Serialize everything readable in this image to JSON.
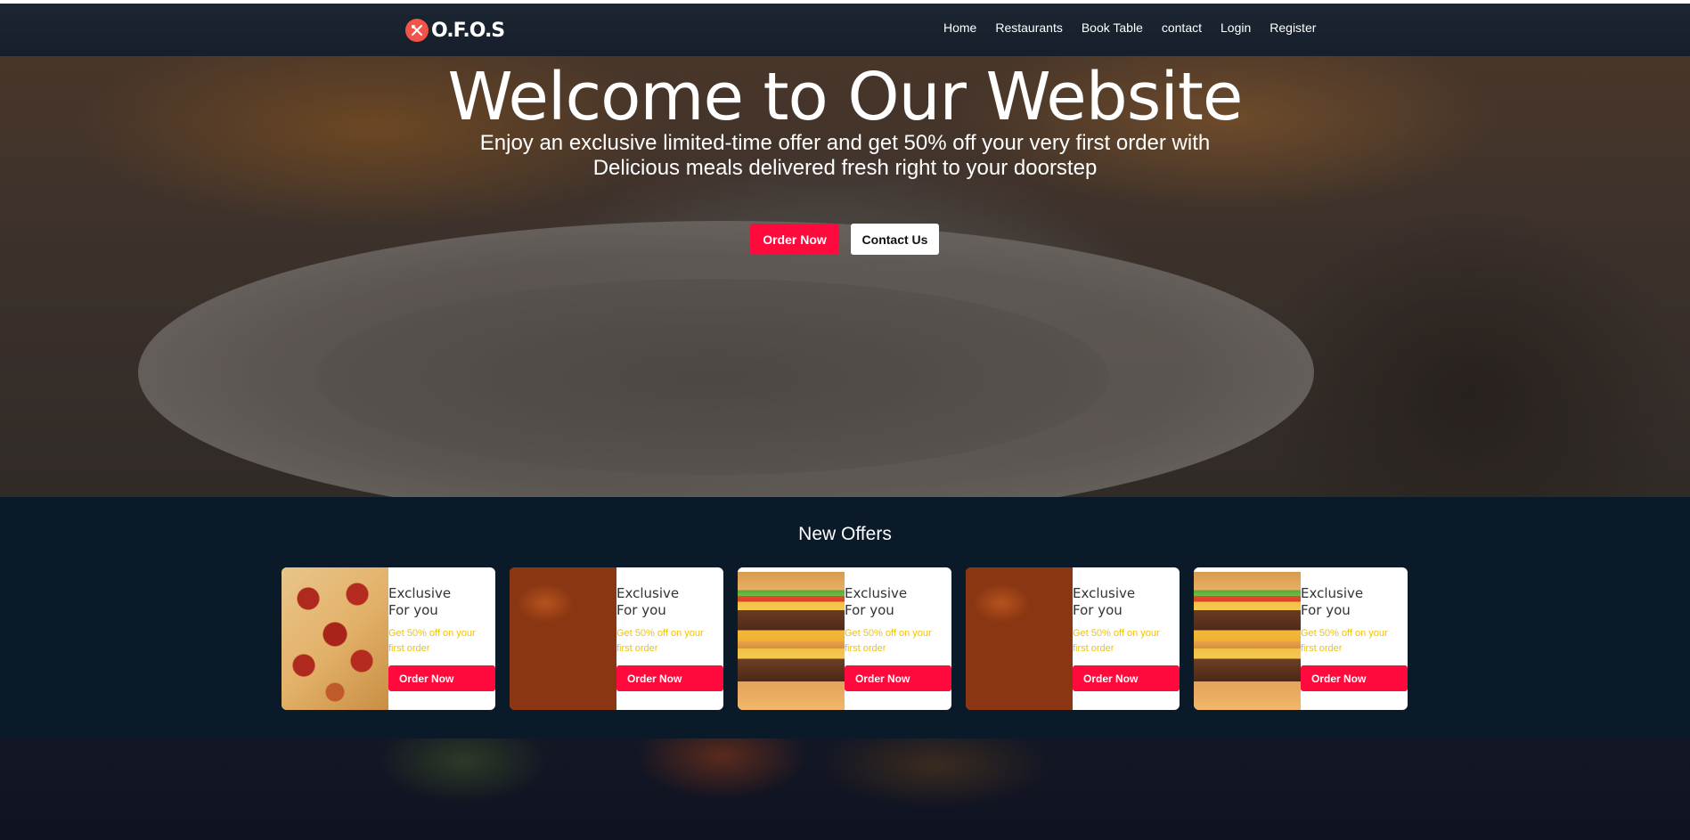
{
  "brand": {
    "name": "O.F.O.S",
    "icon": "fork-spoon-icon",
    "accent": "#f2544a"
  },
  "nav": {
    "items": [
      {
        "label": "Home"
      },
      {
        "label": "Restaurants"
      },
      {
        "label": "Book Table"
      },
      {
        "label": "contact"
      },
      {
        "label": "Login"
      },
      {
        "label": "Register"
      }
    ]
  },
  "hero": {
    "title": "Welcome to Our Website",
    "subtitle_line1": "Enjoy an exclusive limited-time offer and get 50% off your very first order with",
    "subtitle_line2": "Delicious meals delivered fresh right to your doorstep",
    "primary_button": "Order Now",
    "secondary_button": "Contact Us",
    "primary_color": "#ff0a3c"
  },
  "offers": {
    "heading": "New Offers",
    "cards": [
      {
        "image": "pizza",
        "title_line1": "Exclusive",
        "title_line2": "For you",
        "description": "Get 50% off on your first order",
        "button": "Order Now"
      },
      {
        "image": "chicken-wings",
        "title_line1": "Exclusive",
        "title_line2": "For you",
        "description": "Get 50% off on your first order",
        "button": "Order Now"
      },
      {
        "image": "burger",
        "title_line1": "Exclusive",
        "title_line2": "For you",
        "description": "Get 50% off on your first order",
        "button": "Order Now"
      },
      {
        "image": "chicken-wings",
        "title_line1": "Exclusive",
        "title_line2": "For you",
        "description": "Get 50% off on your first order",
        "button": "Order Now"
      },
      {
        "image": "burger",
        "title_line1": "Exclusive",
        "title_line2": "For you",
        "description": "Get 50% off on your first order",
        "button": "Order Now"
      }
    ],
    "description_color": "#f2c200"
  }
}
